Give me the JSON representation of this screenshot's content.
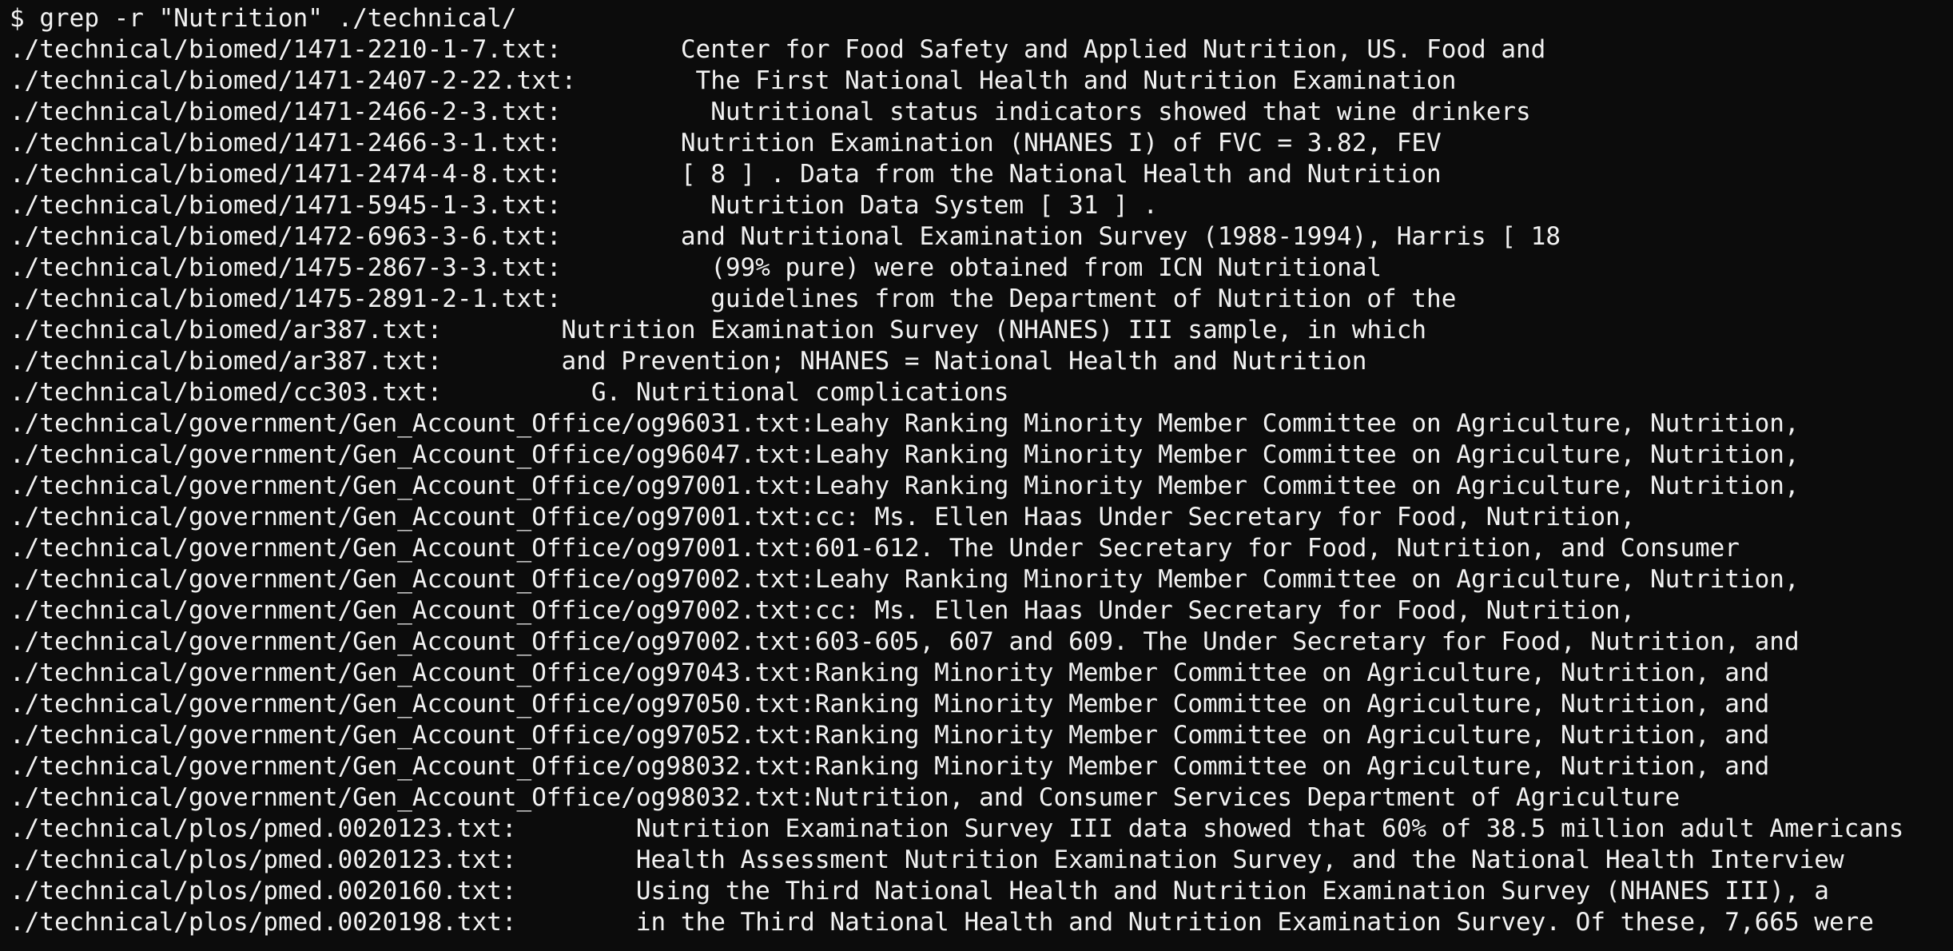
{
  "terminal": {
    "lines": [
      "$ grep -r \"Nutrition\" ./technical/",
      "./technical/biomed/1471-2210-1-7.txt:        Center for Food Safety and Applied Nutrition, US. Food and",
      "./technical/biomed/1471-2407-2-22.txt:        The First National Health and Nutrition Examination",
      "./technical/biomed/1471-2466-2-3.txt:          Nutritional status indicators showed that wine drinkers",
      "./technical/biomed/1471-2466-3-1.txt:        Nutrition Examination (NHANES I) of FVC = 3.82, FEV",
      "./technical/biomed/1471-2474-4-8.txt:        [ 8 ] . Data from the National Health and Nutrition",
      "./technical/biomed/1471-5945-1-3.txt:          Nutrition Data System [ 31 ] .",
      "./technical/biomed/1472-6963-3-6.txt:        and Nutritional Examination Survey (1988-1994), Harris [ 18",
      "./technical/biomed/1475-2867-3-3.txt:          (99% pure) were obtained from ICN Nutritional",
      "./technical/biomed/1475-2891-2-1.txt:          guidelines from the Department of Nutrition of the",
      "./technical/biomed/ar387.txt:        Nutrition Examination Survey (NHANES) III sample, in which",
      "./technical/biomed/ar387.txt:        and Prevention; NHANES = National Health and Nutrition",
      "./technical/biomed/cc303.txt:          G. Nutritional complications",
      "./technical/government/Gen_Account_Office/og96031.txt:Leahy Ranking Minority Member Committee on Agriculture, Nutrition,",
      "./technical/government/Gen_Account_Office/og96047.txt:Leahy Ranking Minority Member Committee on Agriculture, Nutrition,",
      "./technical/government/Gen_Account_Office/og97001.txt:Leahy Ranking Minority Member Committee on Agriculture, Nutrition,",
      "./technical/government/Gen_Account_Office/og97001.txt:cc: Ms. Ellen Haas Under Secretary for Food, Nutrition,",
      "./technical/government/Gen_Account_Office/og97001.txt:601-612. The Under Secretary for Food, Nutrition, and Consumer",
      "./technical/government/Gen_Account_Office/og97002.txt:Leahy Ranking Minority Member Committee on Agriculture, Nutrition,",
      "./technical/government/Gen_Account_Office/og97002.txt:cc: Ms. Ellen Haas Under Secretary for Food, Nutrition,",
      "./technical/government/Gen_Account_Office/og97002.txt:603-605, 607 and 609. The Under Secretary for Food, Nutrition, and",
      "./technical/government/Gen_Account_Office/og97043.txt:Ranking Minority Member Committee on Agriculture, Nutrition, and",
      "./technical/government/Gen_Account_Office/og97050.txt:Ranking Minority Member Committee on Agriculture, Nutrition, and",
      "./technical/government/Gen_Account_Office/og97052.txt:Ranking Minority Member Committee on Agriculture, Nutrition, and",
      "./technical/government/Gen_Account_Office/og98032.txt:Ranking Minority Member Committee on Agriculture, Nutrition, and",
      "./technical/government/Gen_Account_Office/og98032.txt:Nutrition, and Consumer Services Department of Agriculture",
      "./technical/plos/pmed.0020123.txt:        Nutrition Examination Survey III data showed that 60% of 38.5 million adult Americans",
      "./technical/plos/pmed.0020123.txt:        Health Assessment Nutrition Examination Survey, and the National Health Interview",
      "./technical/plos/pmed.0020160.txt:        Using the Third National Health and Nutrition Examination Survey (NHANES III), a",
      "./technical/plos/pmed.0020198.txt:        in the Third National Health and Nutrition Examination Survey. Of these, 7,665 were"
    ]
  }
}
